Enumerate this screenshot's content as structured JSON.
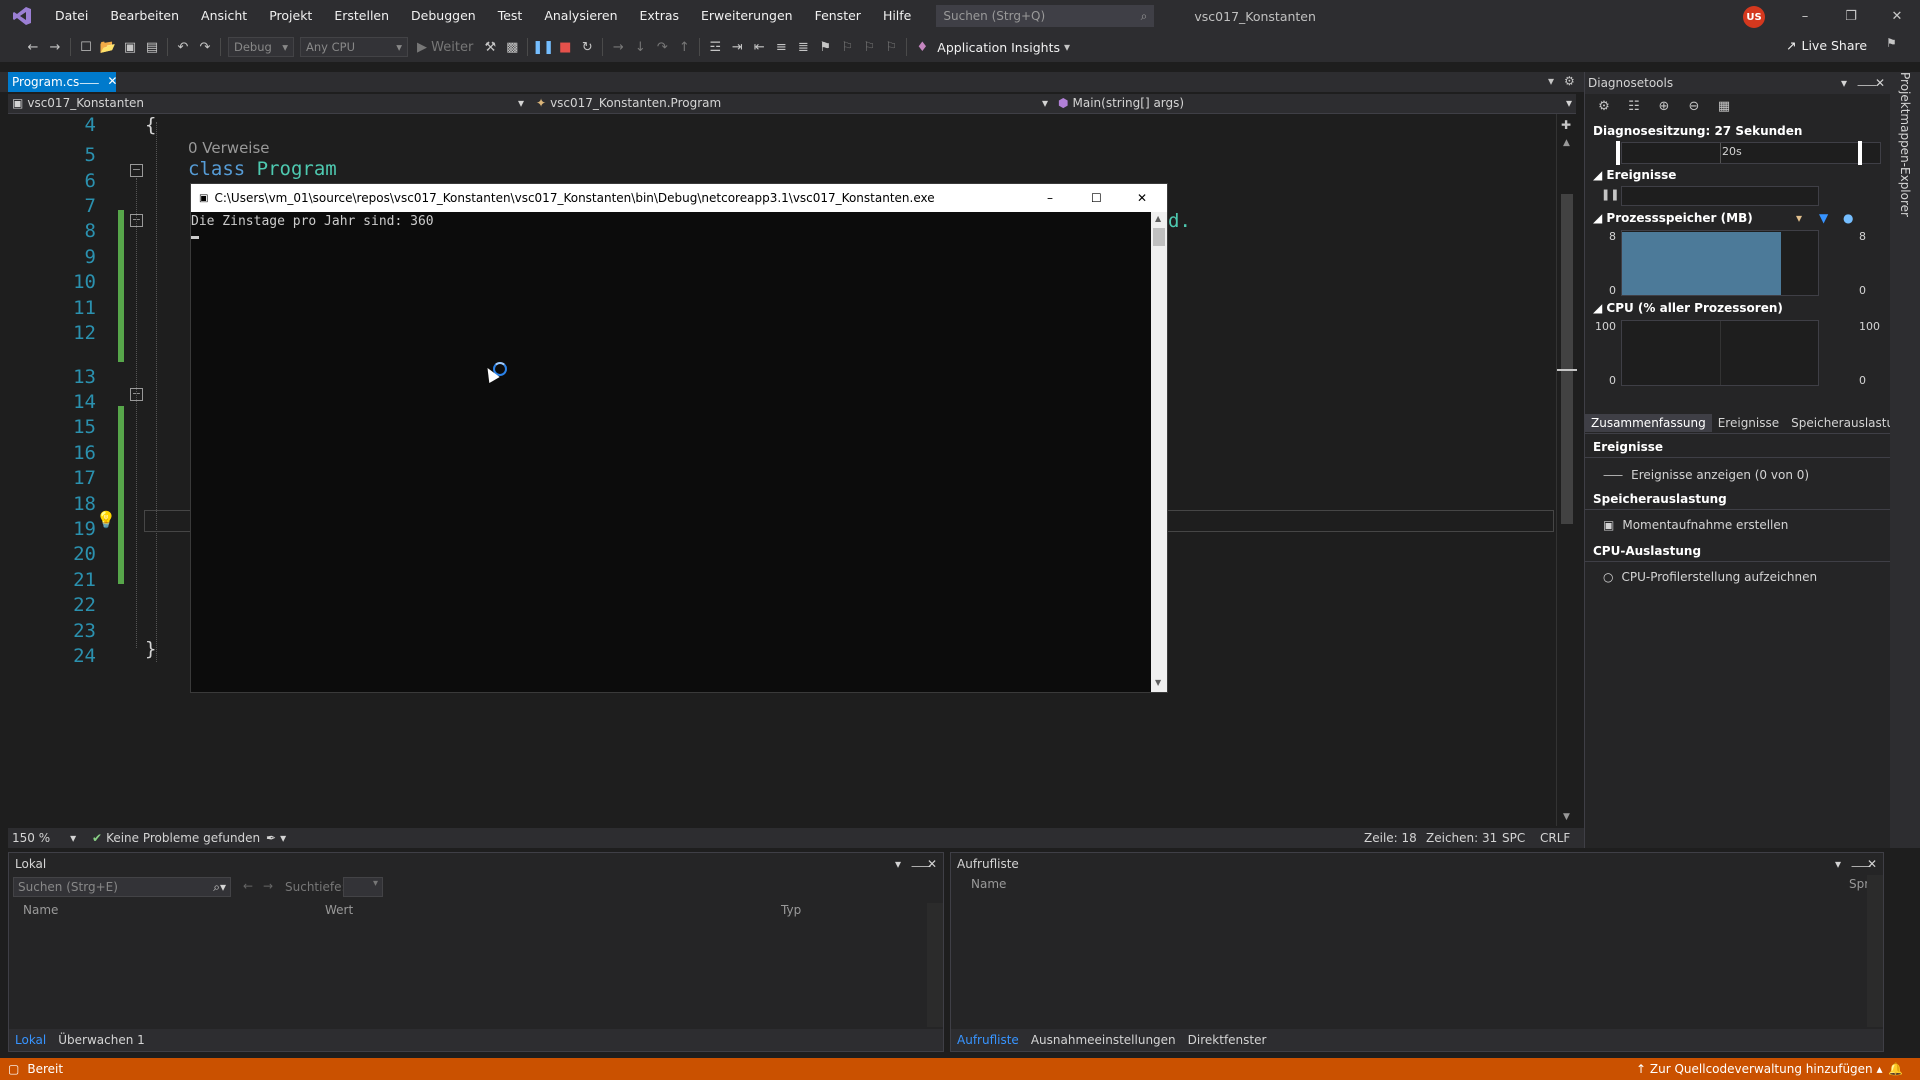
{
  "menu": [
    "Datei",
    "Bearbeiten",
    "Ansicht",
    "Projekt",
    "Erstellen",
    "Debuggen",
    "Test",
    "Analysieren",
    "Extras",
    "Erweiterungen",
    "Fenster",
    "Hilfe"
  ],
  "search": {
    "placeholder": "Suchen (Strg+Q)"
  },
  "solution_name": "vsc017_Konstanten",
  "user_initials": "US",
  "toolbar": {
    "config": "Debug",
    "platform": "Any CPU",
    "continue": "Weiter",
    "app_insights": "Application Insights",
    "live_share": "Live Share"
  },
  "doc_tab": {
    "name": "Program.cs"
  },
  "navbar": {
    "project": "vsc017_Konstanten",
    "class": "vsc017_Konstanten.Program",
    "member": "Main(string[] args)"
  },
  "editor": {
    "refs": "0 Verweise",
    "line_numbers": [
      "4",
      "5",
      "6",
      "7",
      "8",
      "9",
      "10",
      "11",
      "12",
      "13",
      "14",
      "15",
      "16",
      "17",
      "18",
      "19",
      "20",
      "21",
      "22",
      "23",
      "24"
    ],
    "brace_open": "{",
    "class_kw": "class",
    "class_name": "Program",
    "brace_close": "}",
    "peek_text": "d."
  },
  "console": {
    "title": "C:\\Users\\vm_01\\source\\repos\\vsc017_Konstanten\\vsc017_Konstanten\\bin\\Debug\\netcoreapp3.1\\vsc017_Konstanten.exe",
    "output": "Die Zinstage pro Jahr sind: 360"
  },
  "editor_status": {
    "zoom": "150 %",
    "problems": "Keine Probleme gefunden",
    "line": "Zeile: 18",
    "char": "Zeichen: 31",
    "mode": "SPC",
    "eol": "CRLF"
  },
  "diag": {
    "title": "Diagnosetools",
    "session": "Diagnosesitzung: 27 Sekunden",
    "timeline_label": "20s",
    "events_head": "Ereignisse",
    "memory_head": "Prozessspeicher (MB)",
    "memory_max": "8",
    "memory_min": "0",
    "cpu_head": "CPU (% aller Prozessoren)",
    "cpu_max": "100",
    "cpu_min": "0",
    "tabs": [
      "Zusammenfassung",
      "Ereignisse",
      "Speicherauslastur"
    ],
    "sec_events": "Ereignisse",
    "act_events": "Ereignisse anzeigen (0 von 0)",
    "sec_memory": "Speicherauslastung",
    "act_memory": "Momentaufnahme erstellen",
    "sec_cpu": "CPU-Auslastung",
    "act_cpu": "CPU-Profilerstellung aufzeichnen",
    "memory_fraction": 0.98
  },
  "side_strip": "Projektmappen-Explorer",
  "locals": {
    "title": "Lokal",
    "search_placeholder": "Suchen (Strg+E)",
    "depth_label": "Suchtiefe:",
    "columns": [
      "Name",
      "Wert",
      "Typ"
    ],
    "tabs": [
      "Lokal",
      "Überwachen 1"
    ]
  },
  "callstack": {
    "title": "Aufrufliste",
    "columns": [
      "Name",
      "Spra"
    ],
    "tabs": [
      "Aufrufliste",
      "Ausnahmeeinstellungen",
      "Direktfenster"
    ]
  },
  "statusbar": {
    "ready": "Bereit",
    "source_control": "Zur Quellcodeverwaltung hinzufügen"
  },
  "colors": {
    "accent": "#007acc",
    "statusbar": "#ca5100",
    "keyword": "#569cd6",
    "type": "#4ec9b0",
    "line_number": "#2b91af"
  }
}
